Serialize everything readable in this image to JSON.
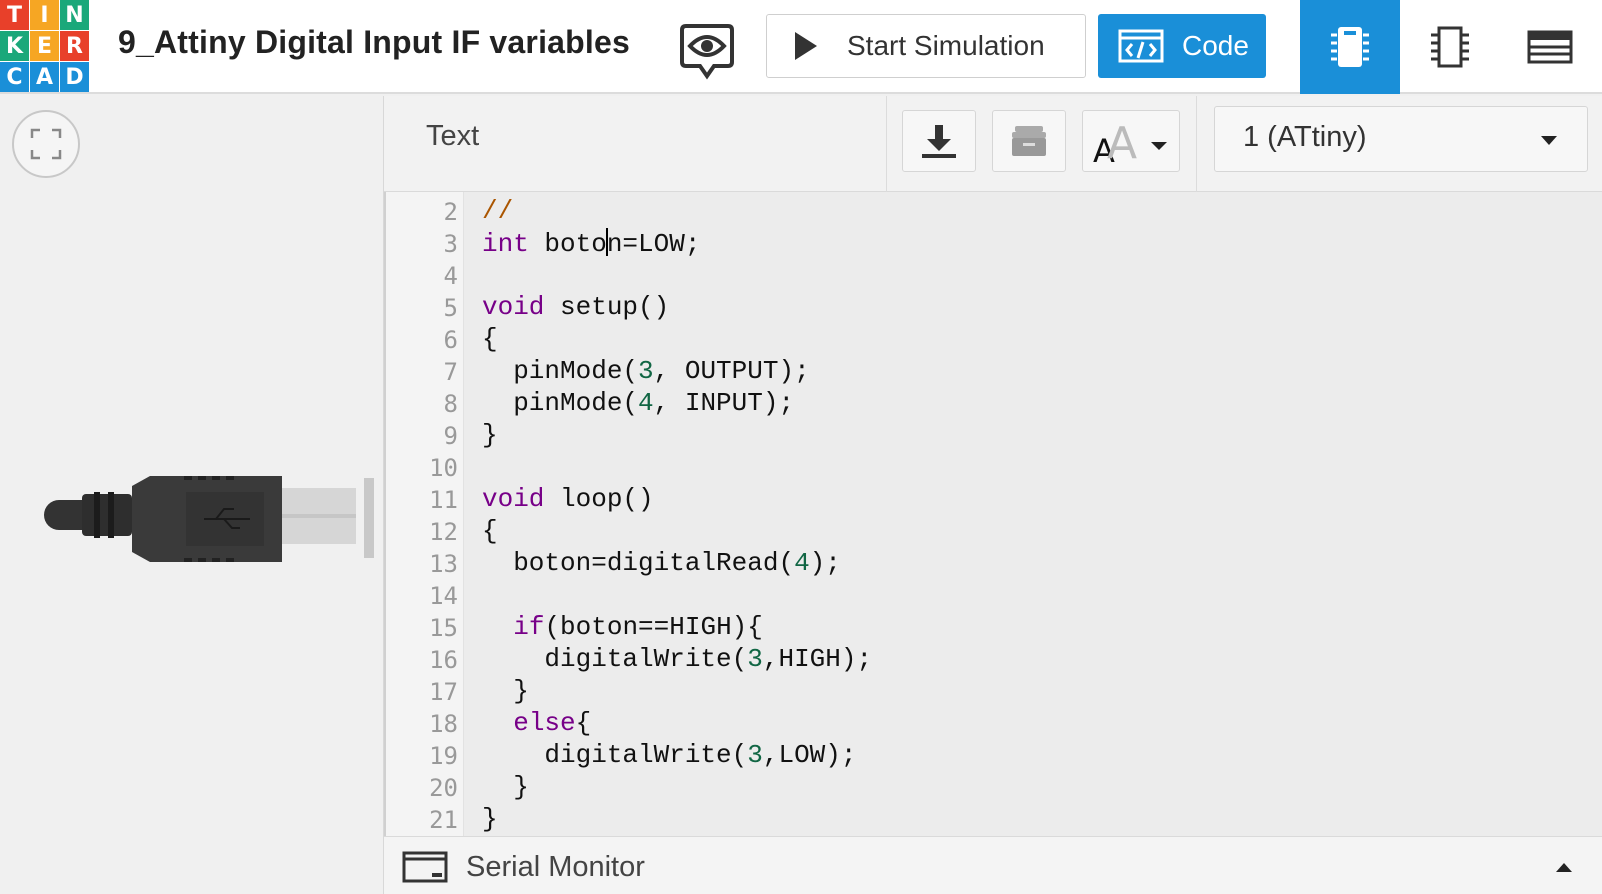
{
  "app": {
    "logo_letters": [
      "T",
      "I",
      "N",
      "K",
      "E",
      "R",
      "C",
      "A",
      "D"
    ],
    "logo_colors": [
      "#e8402a",
      "#f6a623",
      "#1aa87a",
      "#1aa87a",
      "#f6a623",
      "#e8402a",
      "#1a8fd8",
      "#1a8fd8",
      "#1a8fd8"
    ],
    "project_title": "9_Attiny Digital Input IF variables"
  },
  "header": {
    "start_simulation_label": "Start Simulation",
    "code_label": "Code",
    "accent": "#1a8fd8"
  },
  "toolbar": {
    "mode_label": "Text",
    "device_select": "1 (ATtiny)"
  },
  "editor": {
    "line_numbers": [
      "2",
      "3",
      "4",
      "5",
      "6",
      "7",
      "8",
      "9",
      "10",
      "11",
      "12",
      "13",
      "14",
      "15",
      "16",
      "17",
      "18",
      "19",
      "20",
      "21"
    ]
  },
  "serial": {
    "label": "Serial Monitor"
  }
}
